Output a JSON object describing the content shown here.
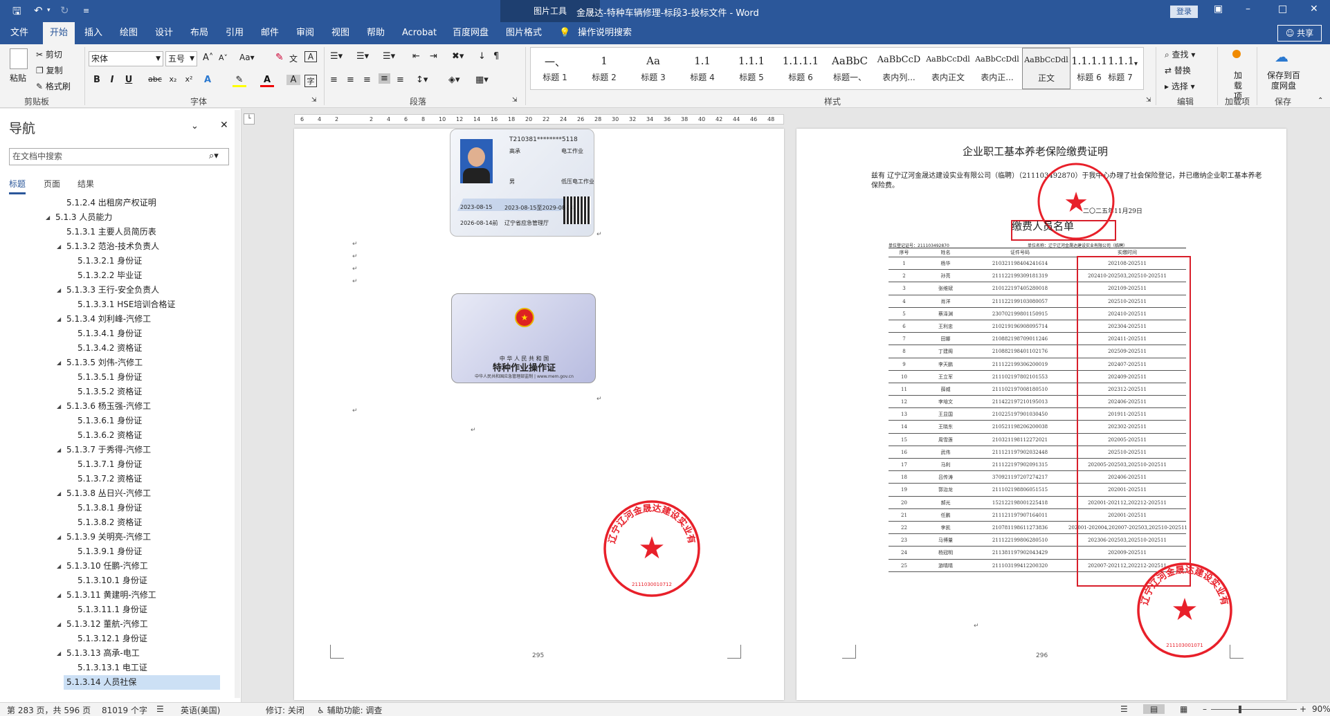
{
  "titlebar": {
    "title": "金晟达-特种车辆修理-标段3-投标文件 - Word",
    "context_tab": "图片工具",
    "login": "登录"
  },
  "tabs": [
    "文件",
    "开始",
    "插入",
    "绘图",
    "设计",
    "布局",
    "引用",
    "邮件",
    "审阅",
    "视图",
    "帮助",
    "Acrobat",
    "百度网盘",
    "图片格式"
  ],
  "tell_me": "操作说明搜索",
  "share": "共享",
  "ribbon": {
    "clipboard": {
      "paste": "粘贴",
      "cut": "剪切",
      "copy": "复制",
      "format_painter": "格式刷",
      "label": "剪贴板"
    },
    "font": {
      "name": "宋体",
      "size": "五号",
      "label": "字体"
    },
    "paragraph": {
      "label": "段落"
    },
    "styles": {
      "label": "样式",
      "items": [
        {
          "preview": "一、",
          "name": "标题 1"
        },
        {
          "preview": "1",
          "name": "标题 2"
        },
        {
          "preview": "Aa",
          "name": "标题 3"
        },
        {
          "preview": "1.1",
          "name": "标题 4"
        },
        {
          "preview": "1.1.1",
          "name": "标题 5"
        },
        {
          "preview": "1.1.1.1",
          "name": "标题 6"
        },
        {
          "preview": "AaBbC",
          "name": "标题一、"
        },
        {
          "preview": "AaBbCcD",
          "name": "表内列..."
        },
        {
          "preview": "AaBbCcDdl",
          "name": "表内正文"
        },
        {
          "preview": "AaBbCcDdl",
          "name": "表内正..."
        },
        {
          "preview": "AaBbCcDdl",
          "name": "正文"
        },
        {
          "preview": "1.1.1.1",
          "name": "标题 6"
        },
        {
          "preview": "1.1.1.1",
          "name": "标题 7"
        }
      ]
    },
    "editing": {
      "find": "查找",
      "replace": "替换",
      "select": "选择",
      "label": "编辑"
    },
    "addins": {
      "btn": "加载项",
      "label": "加载项"
    },
    "save": {
      "btn": "保存到百度网盘",
      "label": "保存"
    }
  },
  "nav": {
    "title": "导航",
    "search_placeholder": "在文档中搜索",
    "tabs": [
      "标题",
      "页面",
      "结果"
    ],
    "items": [
      {
        "t": "5.1.2.4 出租房产权证明",
        "l": 2,
        "toggle": false
      },
      {
        "t": "5.1.3 人员能力",
        "l": 1,
        "toggle": true
      },
      {
        "t": "5.1.3.1 主要人员简历表",
        "l": 2,
        "toggle": false
      },
      {
        "t": "5.1.3.2 范治-技术负责人",
        "l": 2,
        "toggle": true
      },
      {
        "t": "5.1.3.2.1 身份证",
        "l": 3,
        "toggle": false
      },
      {
        "t": "5.1.3.2.2 毕业证",
        "l": 3,
        "toggle": false
      },
      {
        "t": "5.1.3.3 王行-安全负责人",
        "l": 2,
        "toggle": true
      },
      {
        "t": "5.1.3.3.1 HSE培训合格证",
        "l": 3,
        "toggle": false
      },
      {
        "t": "5.1.3.4 刘利峰-汽修工",
        "l": 2,
        "toggle": true
      },
      {
        "t": "5.1.3.4.1 身份证",
        "l": 3,
        "toggle": false
      },
      {
        "t": "5.1.3.4.2 资格证",
        "l": 3,
        "toggle": false
      },
      {
        "t": "5.1.3.5 刘伟-汽修工",
        "l": 2,
        "toggle": true
      },
      {
        "t": "5.1.3.5.1 身份证",
        "l": 3,
        "toggle": false
      },
      {
        "t": "5.1.3.5.2 资格证",
        "l": 3,
        "toggle": false
      },
      {
        "t": "5.1.3.6 杨玉强-汽修工",
        "l": 2,
        "toggle": true
      },
      {
        "t": "5.1.3.6.1 身份证",
        "l": 3,
        "toggle": false
      },
      {
        "t": "5.1.3.6.2 资格证",
        "l": 3,
        "toggle": false
      },
      {
        "t": "5.1.3.7 于秀得-汽修工",
        "l": 2,
        "toggle": true
      },
      {
        "t": "5.1.3.7.1 身份证",
        "l": 3,
        "toggle": false
      },
      {
        "t": "5.1.3.7.2 资格证",
        "l": 3,
        "toggle": false
      },
      {
        "t": "5.1.3.8 丛日兴-汽修工",
        "l": 2,
        "toggle": true
      },
      {
        "t": "5.1.3.8.1 身份证",
        "l": 3,
        "toggle": false
      },
      {
        "t": "5.1.3.8.2 资格证",
        "l": 3,
        "toggle": false
      },
      {
        "t": "5.1.3.9 关明亮-汽修工",
        "l": 2,
        "toggle": true
      },
      {
        "t": "5.1.3.9.1 身份证",
        "l": 3,
        "toggle": false
      },
      {
        "t": "5.1.3.10 任鹏-汽修工",
        "l": 2,
        "toggle": true
      },
      {
        "t": "5.1.3.10.1 身份证",
        "l": 3,
        "toggle": false
      },
      {
        "t": "5.1.3.11 黄建明-汽修工",
        "l": 2,
        "toggle": true
      },
      {
        "t": "5.1.3.11.1 身份证",
        "l": 3,
        "toggle": false
      },
      {
        "t": "5.1.3.12 董航-汽修工",
        "l": 2,
        "toggle": true
      },
      {
        "t": "5.1.3.12.1 身份证",
        "l": 3,
        "toggle": false
      },
      {
        "t": "5.1.3.13 高承-电工",
        "l": 2,
        "toggle": true
      },
      {
        "t": "5.1.3.13.1 电工证",
        "l": 3,
        "toggle": false
      },
      {
        "t": "5.1.3.14 人员社保",
        "l": 2,
        "toggle": false,
        "selected": true
      }
    ]
  },
  "page1": {
    "card1": {
      "cert_no": "T210381********5118",
      "name": "高承",
      "sex": "男",
      "job": "电工作业",
      "job_item": "低压电工作业",
      "issue": "2023-08-15",
      "valid": "2023-08-15至2029-08-14",
      "review": "2026-08-14前",
      "authority": "辽宁省应急管理厅"
    },
    "card2": {
      "country": "中 华 人 民 共 和 国",
      "title": "特种作业操作证",
      "footer": "中华人民共和国应急管理部监制 | www.mem.gov.cn"
    },
    "page_no": "295",
    "stamp_text": "辽宁辽河金晟达建设实业有限公司",
    "stamp_no": "2111030010712"
  },
  "page2": {
    "heading": "企业职工基本养老保险缴费证明",
    "para": "兹有 辽宁辽河金晟达建设实业有限公司（临聘）（211103492870）于我中心办理了社会保险登记，并已缴纳企业职工基本养老保险费。",
    "date": "二〇二五年11月29日",
    "list_title": "缴费人员名单",
    "reg_no": "单位登记证号：211103492870",
    "unit_name": "单位名称：辽宁辽河金晟达建设实业有限公司（临聘）",
    "headers": [
      "序号",
      "姓名",
      "证件号码",
      "实缴时间"
    ],
    "rows": [
      [
        "1",
        "杨华",
        "210321198404241614",
        "202108-202511"
      ],
      [
        "2",
        "孙亮",
        "211122199309181319",
        "202410-202503,202510-202511"
      ],
      [
        "3",
        "张维斌",
        "210122197405280018",
        "202109-202511"
      ],
      [
        "4",
        "肖洋",
        "211122199103080057",
        "202510-202511"
      ],
      [
        "5",
        "蔡泽渊",
        "230702199801150915",
        "202410-202511"
      ],
      [
        "6",
        "王利忠",
        "210219196908095714",
        "202304-202511"
      ],
      [
        "7",
        "田娜",
        "210882198709011246",
        "202411-202511"
      ],
      [
        "8",
        "丁建阁",
        "210882198401102176",
        "202509-202511"
      ],
      [
        "9",
        "李天鹏",
        "211122199306200019",
        "202407-202511"
      ],
      [
        "10",
        "王立军",
        "211102197802101553",
        "202409-202511"
      ],
      [
        "11",
        "薛威",
        "211102197008180510",
        "202312-202511"
      ],
      [
        "12",
        "李培文",
        "211422197210195013",
        "202406-202511"
      ],
      [
        "13",
        "王显国",
        "210225197901030450",
        "201911-202511"
      ],
      [
        "14",
        "王晓东",
        "210521198206200038",
        "202302-202511"
      ],
      [
        "15",
        "周雪莲",
        "210321198112272021",
        "202005-202511"
      ],
      [
        "16",
        "武伟",
        "211121197902032448",
        "202510-202511"
      ],
      [
        "17",
        "马利",
        "211122197902091315",
        "202005-202503,202510-202511"
      ],
      [
        "18",
        "吕传涛",
        "370921197207274217",
        "202406-202511"
      ],
      [
        "19",
        "郭治龙",
        "211102198806051515",
        "202001-202511"
      ],
      [
        "20",
        "郝光",
        "152122198001225418",
        "202001-202112,202212-202511"
      ],
      [
        "21",
        "任鹏",
        "211121197907164011",
        "202001-202511"
      ],
      [
        "22",
        "李凯",
        "210781198611273836",
        "202001-202004,202007-202503,202510-202511"
      ],
      [
        "23",
        "马博量",
        "211122199806280510",
        "202306-202503,202510-202511"
      ],
      [
        "24",
        "杨冠明",
        "211381197902043429",
        "202009-202511"
      ],
      [
        "25",
        "游晴晴",
        "211103199412200320",
        "202007-202112,202212-202511"
      ]
    ],
    "page_no": "296",
    "seal_text": "辽宁辽河金晟达建设实业有限公司",
    "seal_no": "211103001071",
    "small_seal": "辽河金晟达建设实业有限公司"
  },
  "status": {
    "page": "第 283 页，共 596 页",
    "words": "81019 个字",
    "lang": "英语(美国)",
    "track": "修订: 关闭",
    "access": "辅助功能: 调查",
    "zoom": "90%"
  },
  "colors": {
    "accent": "#2b579a",
    "stamp": "#e8202a",
    "highlight": "#d81e2a"
  }
}
